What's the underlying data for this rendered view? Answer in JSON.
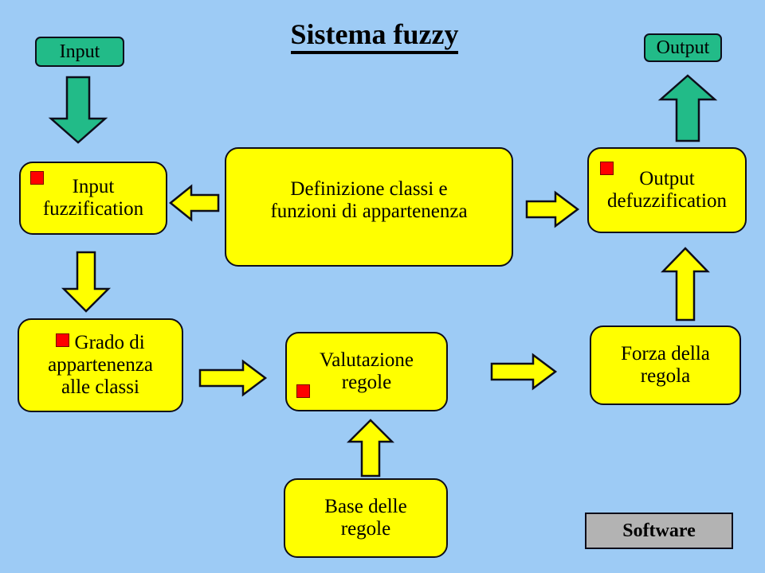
{
  "page": {
    "title": "Sistema fuzzy",
    "background_color": "#9dcbf5"
  },
  "colors": {
    "background": "#9dcbf5",
    "process_box": "#ffff00",
    "io_box": "#22bb88",
    "legend_box": "#b3b3b3",
    "marker": "#ff0000",
    "outline": "#0d0d1a",
    "arrow_yellow": "#ffff00",
    "arrow_green": "#22bb88"
  },
  "nodes": {
    "input": {
      "label": "Input",
      "type": "io",
      "marker": false
    },
    "output": {
      "label": "Output",
      "type": "io",
      "marker": false
    },
    "input_fuzzification": {
      "line1": "Input",
      "line2": "fuzzification",
      "type": "process",
      "marker": true
    },
    "definizione": {
      "line1": "Definizione classi e",
      "line2": "funzioni di appartenenza",
      "type": "process",
      "marker": false
    },
    "output_defuzzification": {
      "line1": "Output",
      "line2": "defuzzification",
      "type": "process",
      "marker": true
    },
    "grado": {
      "line1": "Grado di",
      "line2": "appartenenza",
      "line3": "alle classi",
      "type": "process",
      "marker": true
    },
    "valutazione": {
      "line1": "Valutazione",
      "line2": "regole",
      "type": "process",
      "marker": true
    },
    "forza": {
      "line1": "Forza della",
      "line2": "regola",
      "type": "process",
      "marker": false
    },
    "base_regole": {
      "line1": "Base delle",
      "line2": "regole",
      "type": "process",
      "marker": false
    },
    "software_legend": {
      "label": "Software",
      "type": "legend",
      "marker": false
    }
  },
  "arrows": [
    {
      "name": "input-to-input-fuzzification",
      "direction": "down",
      "color": "#22bb88"
    },
    {
      "name": "output-defuzzification-to-output",
      "direction": "up",
      "color": "#22bb88"
    },
    {
      "name": "definizione-to-input-fuzzification",
      "direction": "left",
      "color": "#ffff00"
    },
    {
      "name": "definizione-to-output-defuzzification",
      "direction": "right",
      "color": "#ffff00"
    },
    {
      "name": "input-fuzzification-to-grado",
      "direction": "down",
      "color": "#ffff00"
    },
    {
      "name": "grado-to-valutazione",
      "direction": "right",
      "color": "#ffff00"
    },
    {
      "name": "valutazione-to-forza",
      "direction": "right",
      "color": "#ffff00"
    },
    {
      "name": "forza-to-output-defuzzification",
      "direction": "up",
      "color": "#ffff00"
    },
    {
      "name": "base-regole-to-valutazione",
      "direction": "up",
      "color": "#ffff00"
    }
  ]
}
